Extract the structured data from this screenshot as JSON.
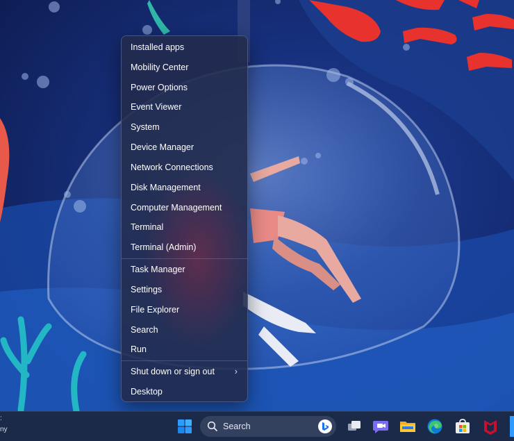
{
  "context_menu": {
    "items": [
      {
        "label": "Installed apps"
      },
      {
        "label": "Mobility Center"
      },
      {
        "label": "Power Options"
      },
      {
        "label": "Event Viewer"
      },
      {
        "label": "System"
      },
      {
        "label": "Device Manager"
      },
      {
        "label": "Network Connections"
      },
      {
        "label": "Disk Management"
      },
      {
        "label": "Computer Management"
      },
      {
        "label": "Terminal"
      },
      {
        "label": "Terminal (Admin)"
      },
      {
        "label": "Task Manager"
      },
      {
        "label": "Settings"
      },
      {
        "label": "File Explorer"
      },
      {
        "label": "Search"
      },
      {
        "label": "Run"
      },
      {
        "label": "Shut down or sign out",
        "submenu_glyph": "›"
      },
      {
        "label": "Desktop"
      }
    ]
  },
  "taskbar": {
    "left_widget_line1": ":",
    "left_widget_line2": "ny",
    "search_label": "Search",
    "icons": [
      "start-icon",
      "search-icon",
      "bing-icon",
      "task-view-icon",
      "teams-chat-icon",
      "file-explorer-icon",
      "edge-icon",
      "microsoft-store-icon",
      "mcafee-icon"
    ]
  },
  "colors": {
    "menu_background": "#222b4e",
    "taskbar_background": "#1c2a4a",
    "wallpaper_deep": "#0e1a4a",
    "wallpaper_water": "#1e5bb8",
    "fish_red": "#e8322e"
  }
}
